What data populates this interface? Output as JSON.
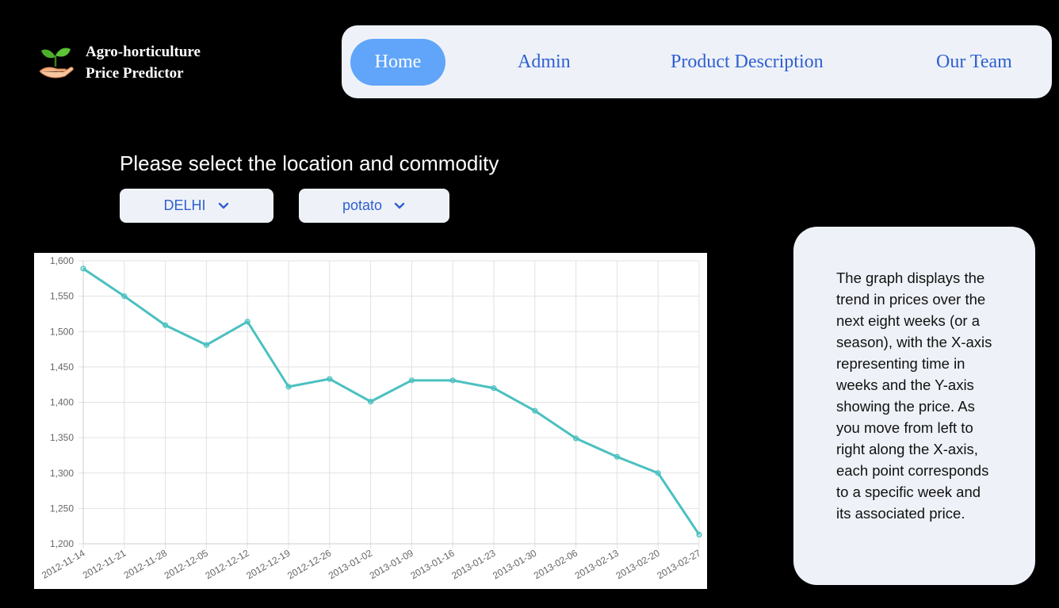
{
  "brand": {
    "line1": "Agro-horticulture",
    "line2": "Price Predictor",
    "logo_icon": "plant-hand-icon"
  },
  "nav": {
    "items": [
      {
        "label": "Home",
        "active": true
      },
      {
        "label": "Admin",
        "active": false
      },
      {
        "label": "Product Description",
        "active": false
      },
      {
        "label": "Our Team",
        "active": false
      }
    ]
  },
  "selector": {
    "prompt": "Please select the location and commodity",
    "location": "DELHI",
    "commodity": "potato"
  },
  "chart_data": {
    "type": "line",
    "categories": [
      "2012-11-14",
      "2012-11-21",
      "2012-11-28",
      "2012-12-05",
      "2012-12-12",
      "2012-12-19",
      "2012-12-26",
      "2013-01-02",
      "2013-01-09",
      "2013-01-16",
      "2013-01-23",
      "2013-01-30",
      "2013-02-06",
      "2013-02-13",
      "2013-02-20",
      "2013-02-27"
    ],
    "values": [
      1589,
      1550,
      1509,
      1481,
      1514,
      1422,
      1433,
      1401,
      1431,
      1431,
      1420,
      1388,
      1349,
      1323,
      1300,
      1213
    ],
    "ylim": [
      1200,
      1600
    ],
    "yticks": [
      1200,
      1250,
      1300,
      1350,
      1400,
      1450,
      1500,
      1550,
      1600
    ],
    "ytick_labels": [
      "1,200",
      "1,250",
      "1,300",
      "1,350",
      "1,400",
      "1,450",
      "1,500",
      "1,550",
      "1,600"
    ],
    "grid": true,
    "line_color": "#4bc0c0",
    "title": "",
    "xlabel": "",
    "ylabel": ""
  },
  "info": {
    "text": "The graph displays the trend in prices over the next eight weeks (or a season), with the X-axis representing time in weeks and the Y-axis showing the price. As you move from left to right along the X-axis, each point corresponds to a specific week and its associated price."
  },
  "colors": {
    "accent": "#60a5fa",
    "nav_text": "#2f5fd0",
    "panel_bg": "#eef2f8"
  }
}
